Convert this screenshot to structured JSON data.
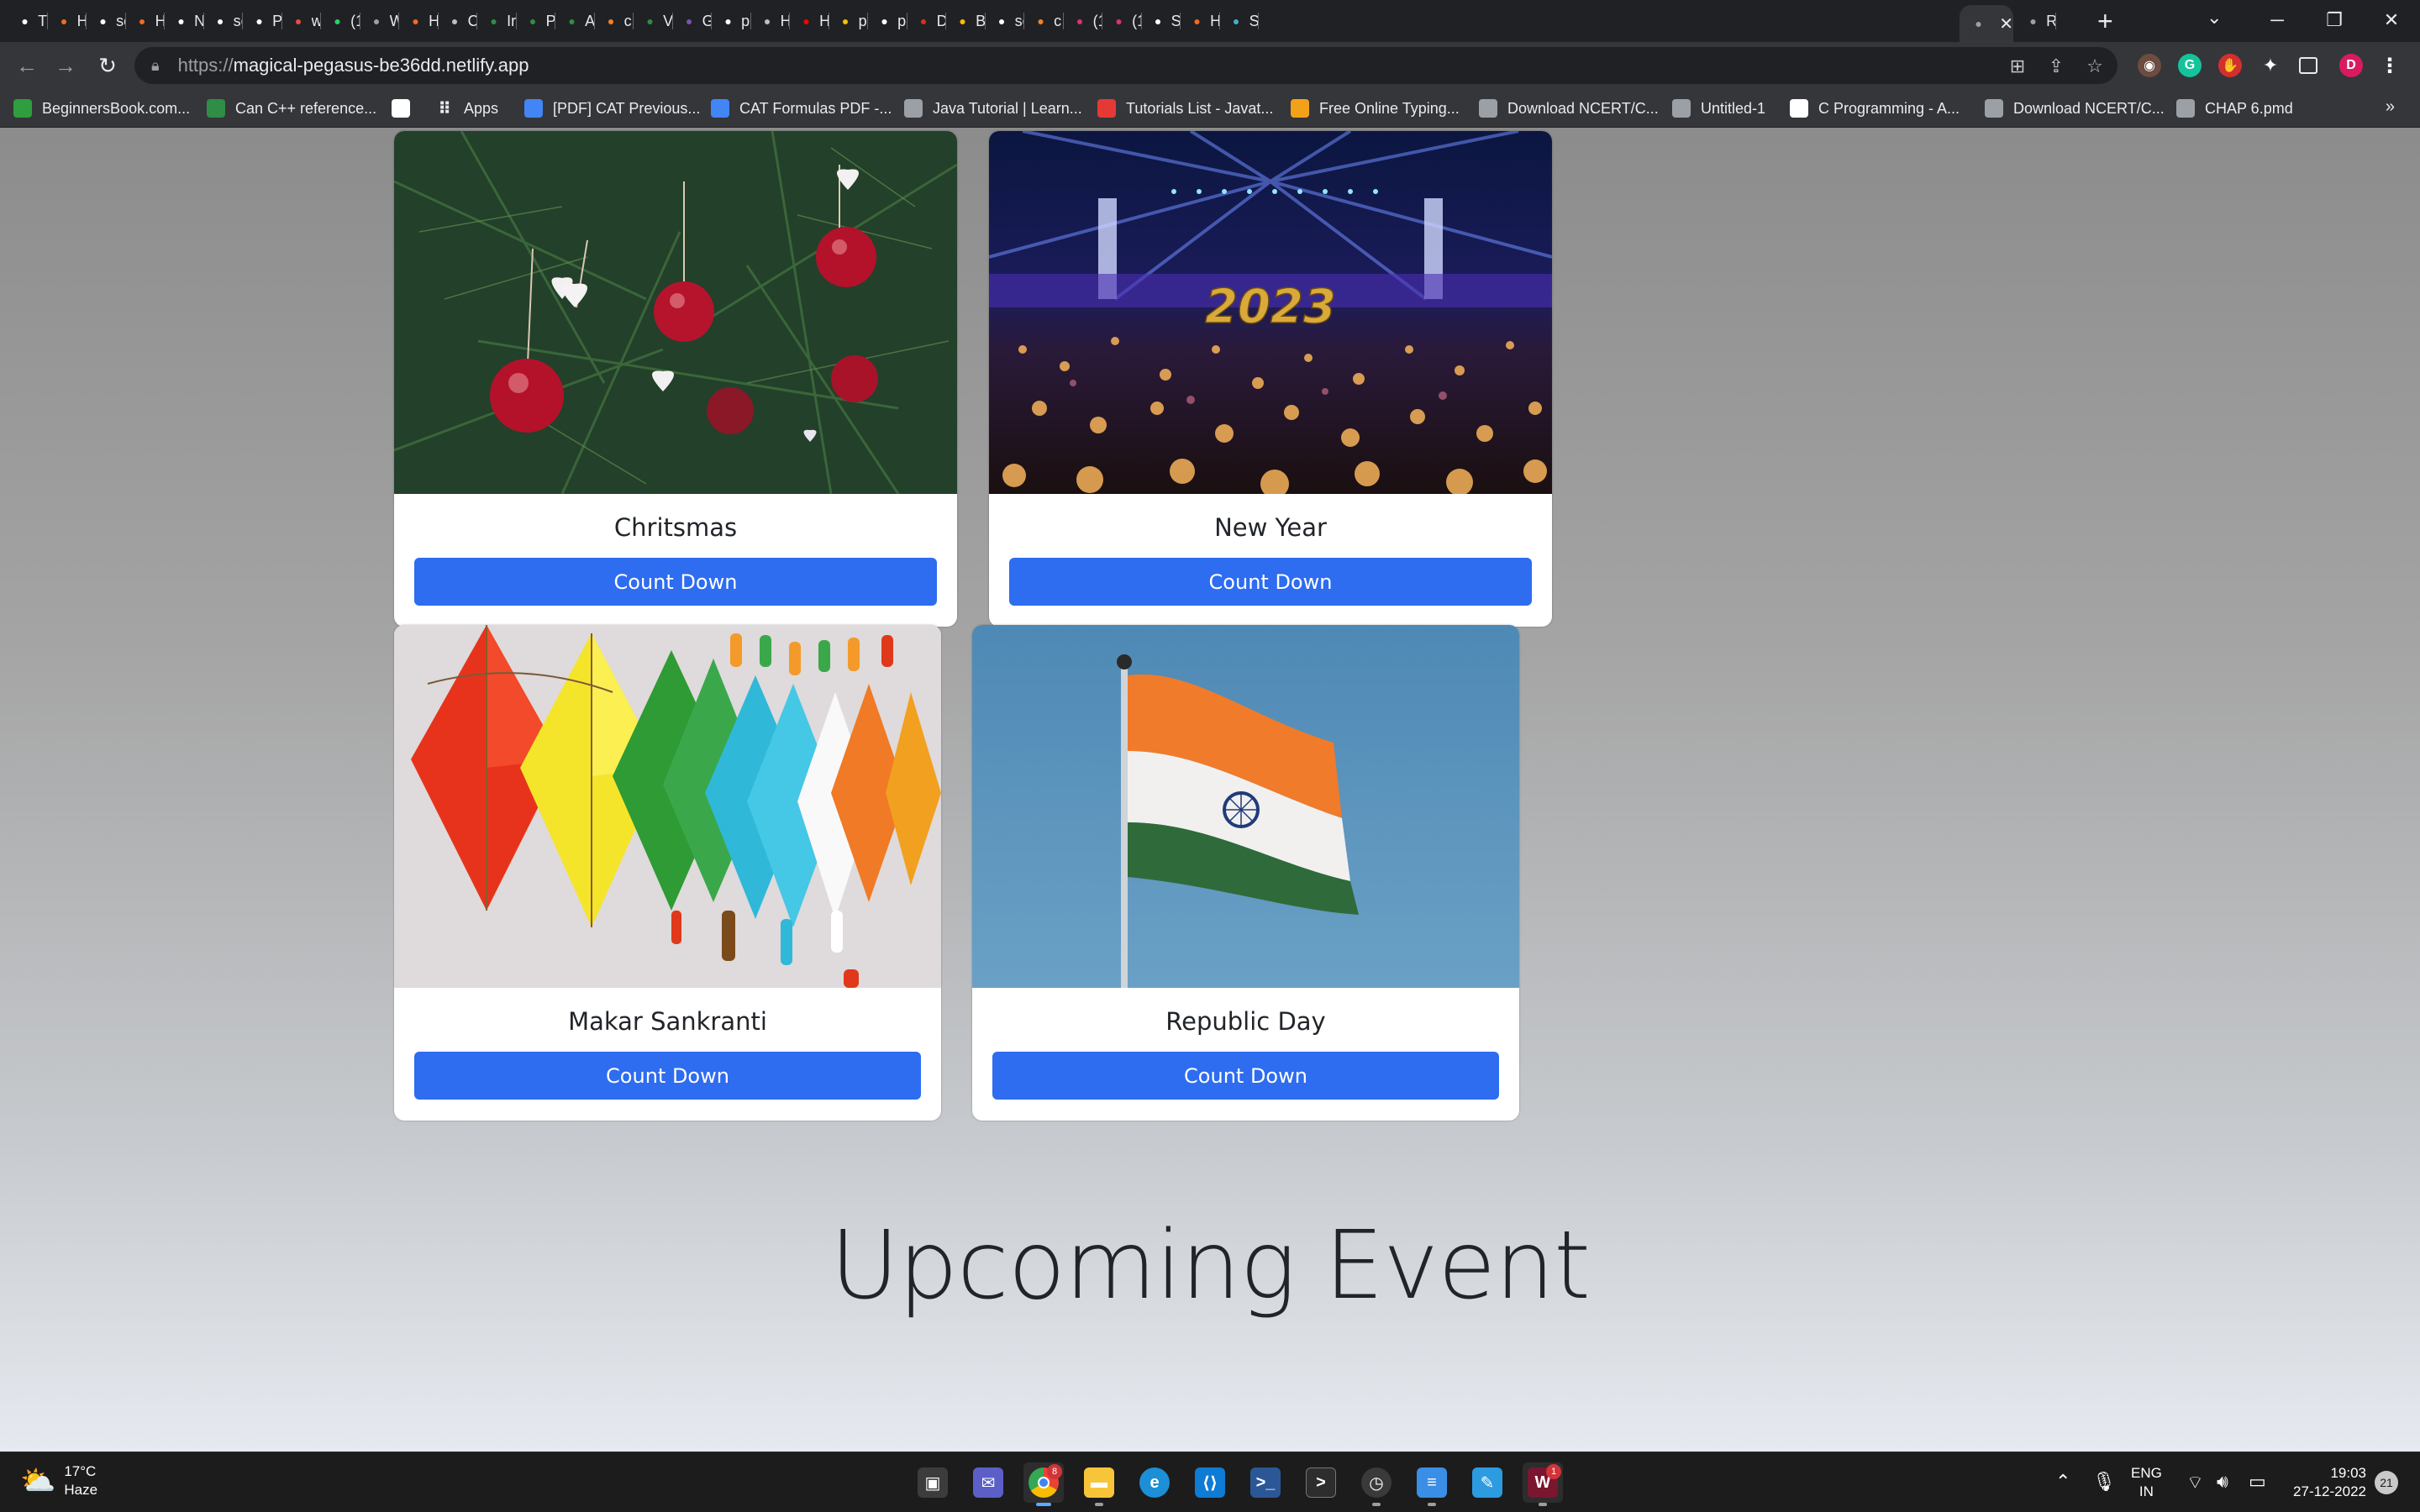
{
  "tabs": [
    {
      "title": "Tr",
      "icon": "trello-icon",
      "color": "#ffffff"
    },
    {
      "title": "H",
      "icon": "hashnode-icon",
      "color": "#f26a21"
    },
    {
      "title": "se",
      "icon": "github-icon",
      "color": "#ffffff"
    },
    {
      "title": "H",
      "icon": "hashnode-icon",
      "color": "#f26a21"
    },
    {
      "title": "N",
      "icon": "github-icon",
      "color": "#ffffff"
    },
    {
      "title": "se",
      "icon": "github-icon",
      "color": "#ffffff"
    },
    {
      "title": "Pr",
      "icon": "app-icon",
      "color": "#ffffff"
    },
    {
      "title": "w",
      "icon": "code-icon",
      "color": "#e94e3c"
    },
    {
      "title": "(1",
      "icon": "whatsapp-icon",
      "color": "#25d366"
    },
    {
      "title": "W",
      "icon": "globe-icon",
      "color": "#9aa0a6"
    },
    {
      "title": "H",
      "icon": "hashnode-icon",
      "color": "#f26a21"
    },
    {
      "title": "C",
      "icon": "cc-icon",
      "color": "#bdbdbd"
    },
    {
      "title": "Ir",
      "icon": "gfg-icon",
      "color": "#2f8d46"
    },
    {
      "title": "Pr",
      "icon": "gfg-icon",
      "color": "#2f8d46"
    },
    {
      "title": "A",
      "icon": "gfg-icon",
      "color": "#2f8d46"
    },
    {
      "title": "c",
      "icon": "stackoverflow-icon",
      "color": "#f48024"
    },
    {
      "title": "V",
      "icon": "gfg-icon",
      "color": "#2f8d46"
    },
    {
      "title": "G",
      "icon": "bootstrap-icon",
      "color": "#7952b3"
    },
    {
      "title": "p",
      "icon": "google-icon",
      "color": "#ffffff"
    },
    {
      "title": "H",
      "icon": "hackerrank-icon",
      "color": "#bdbdbd"
    },
    {
      "title": "H",
      "icon": "youtube-icon",
      "color": "#ff0000"
    },
    {
      "title": "p",
      "icon": "drive-icon",
      "color": "#fbbc04"
    },
    {
      "title": "p",
      "icon": "github-icon",
      "color": "#ffffff"
    },
    {
      "title": "D",
      "icon": "gmail-icon",
      "color": "#d93025"
    },
    {
      "title": "B",
      "icon": "drive-icon",
      "color": "#fbbc04"
    },
    {
      "title": "se",
      "icon": "github-icon",
      "color": "#ffffff"
    },
    {
      "title": "c",
      "icon": "stackoverflow-icon",
      "color": "#f48024"
    },
    {
      "title": "(1",
      "icon": "instagram-icon",
      "color": "#e1306c"
    },
    {
      "title": "(1",
      "icon": "instagram-icon",
      "color": "#e1306c"
    },
    {
      "title": "Si",
      "icon": "trello-icon",
      "color": "#ffffff"
    },
    {
      "title": "H",
      "icon": "hashnode-icon",
      "color": "#f26a21"
    },
    {
      "title": "Si",
      "icon": "diamond-icon",
      "color": "#3fb0c9"
    },
    {
      "title": "",
      "icon": "globe-icon",
      "color": "#9aa0a6",
      "active": true
    },
    {
      "title": "R",
      "icon": "globe-icon",
      "color": "#9aa0a6"
    }
  ],
  "url": {
    "prefix": "https://",
    "host": "magical-pegasus-be36dd.netlify.app"
  },
  "bookmarks": [
    {
      "label": "BeginnersBook.com...",
      "icon": "beginnersbook-icon",
      "color": "#2e9e3e"
    },
    {
      "label": "Can C++ reference...",
      "icon": "gfg-icon",
      "color": "#2f8d46"
    },
    {
      "label": "",
      "icon": "google-icon",
      "color": "#ffffff"
    },
    {
      "label": "Apps",
      "icon": "apps-grid-icon",
      "color": "#e8eaed"
    },
    {
      "label": "[PDF] CAT Previous...",
      "icon": "doc-icon",
      "color": "#4285f4"
    },
    {
      "label": "CAT Formulas PDF -...",
      "icon": "doc-icon",
      "color": "#4285f4"
    },
    {
      "label": "Java Tutorial | Learn...",
      "icon": "globe-icon",
      "color": "#9aa0a6"
    },
    {
      "label": "Tutorials List - Javat...",
      "icon": "javatpoint-icon",
      "color": "#e53935"
    },
    {
      "label": "Free Online Typing...",
      "icon": "typing-icon",
      "color": "#f4a11a"
    },
    {
      "label": "Download NCERT/C...",
      "icon": "globe-icon",
      "color": "#9aa0a6"
    },
    {
      "label": "Untitled-1",
      "icon": "globe-icon",
      "color": "#9aa0a6"
    },
    {
      "label": "C Programming - A...",
      "icon": "w3-icon",
      "color": "#ffffff"
    },
    {
      "label": "Download NCERT/C...",
      "icon": "globe-icon",
      "color": "#9aa0a6"
    },
    {
      "label": "CHAP 6.pmd",
      "icon": "globe-icon",
      "color": "#9aa0a6"
    }
  ],
  "cards": [
    {
      "title": "Chritsmas",
      "button": "Count Down",
      "image": "christmas-ornaments"
    },
    {
      "title": "New Year",
      "button": "Count Down",
      "image": "new-year-2023-concert"
    },
    {
      "title": "Makar Sankranti",
      "button": "Count Down",
      "image": "colorful-kites"
    },
    {
      "title": "Republic Day",
      "button": "Count Down",
      "image": "indian-flag"
    }
  ],
  "new_year_banner": "2023",
  "heading": "Upcoming Event",
  "taskbar": {
    "weather_temp": "17°C",
    "weather_desc": "Haze",
    "chrome_badge": "8",
    "app_badge": "1",
    "lang_line1": "ENG",
    "lang_line2": "IN",
    "time": "19:03",
    "date": "27-12-2022",
    "notifications": "21"
  },
  "profile_initial": "D",
  "colors": {
    "accent_button": "#2e6cf0",
    "chrome_dark": "#202124",
    "chrome_toolbar": "#35363a"
  }
}
